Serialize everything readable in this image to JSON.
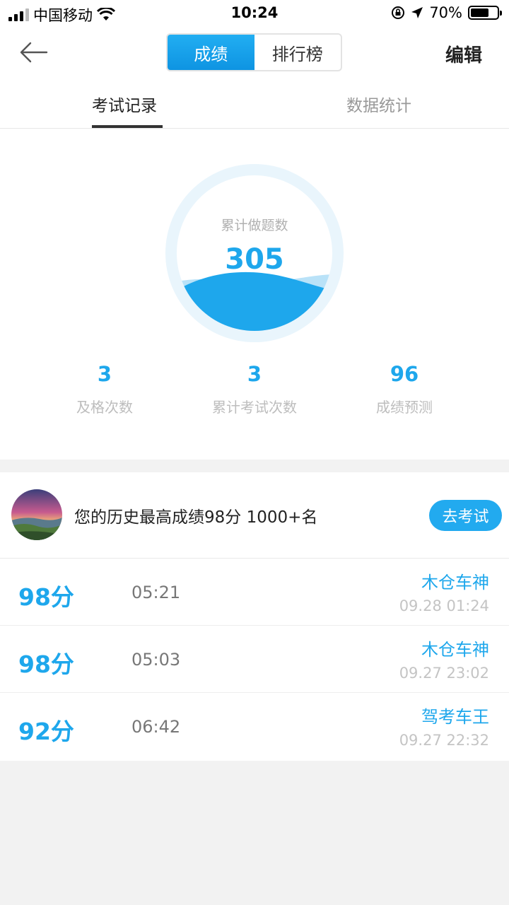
{
  "status_bar": {
    "carrier": "中国移动",
    "time": "10:24",
    "battery_percent": "70%",
    "battery_level": 0.7
  },
  "nav": {
    "segments": [
      "成绩",
      "排行榜"
    ],
    "active_segment": 0,
    "edit_label": "编辑"
  },
  "tabs": [
    "考试记录",
    "数据统计"
  ],
  "summary": {
    "gauge_label": "累计做题数",
    "gauge_value": "305",
    "stats": [
      {
        "value": "3",
        "label": "及格次数"
      },
      {
        "value": "3",
        "label": "累计考试次数"
      },
      {
        "value": "96",
        "label": "成绩预测"
      }
    ]
  },
  "best": {
    "text": "您的历史最高成绩98分 1000+名",
    "button_label": "去考试"
  },
  "records": [
    {
      "score": "98分",
      "duration": "05:21",
      "title": "木仓车神",
      "date": "09.28 01:24"
    },
    {
      "score": "98分",
      "duration": "05:03",
      "title": "木仓车神",
      "date": "09.27 23:02"
    },
    {
      "score": "92分",
      "duration": "06:42",
      "title": "驾考车王",
      "date": "09.27 22:32"
    }
  ],
  "colors": {
    "accent": "#1ea7ec",
    "button": "#22aaef",
    "background": "#f2f2f2"
  },
  "icons": {
    "back": "arrow-left-icon",
    "wifi": "wifi-icon",
    "lock": "orientation-lock-icon",
    "location": "location-arrow-icon"
  }
}
